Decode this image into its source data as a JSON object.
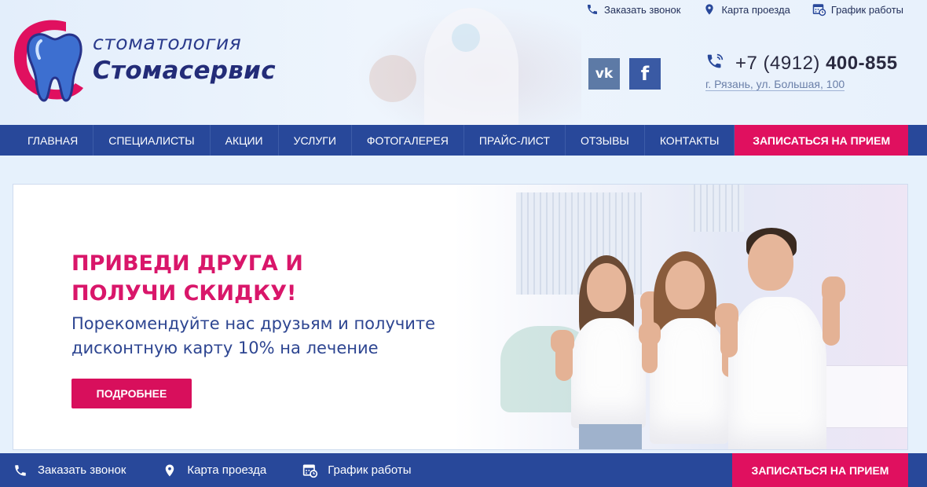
{
  "header": {
    "logo": {
      "top_text": "стоматология",
      "main_text": "Стомасервис"
    },
    "top_links": [
      {
        "label": "Заказать звонок",
        "icon": "phone-icon"
      },
      {
        "label": "Карта проезда",
        "icon": "map-pin-icon"
      },
      {
        "label": "График работы",
        "icon": "calendar-clock-icon"
      }
    ],
    "social": {
      "vk": "vk",
      "fb": "f"
    },
    "phone": {
      "prefix": "+7 (4912) ",
      "number": "400-855"
    },
    "address": "г. Рязань, ул. Большая, 100"
  },
  "nav": {
    "items": [
      "Главная",
      "Специалисты",
      "Акции",
      "Услуги",
      "Фотогалерея",
      "Прайс-лист",
      "Отзывы",
      "Контакты"
    ],
    "cta": "ЗАПИСАТЬСЯ НА ПРИЕМ"
  },
  "banner": {
    "title_line1": "Приведи друга и",
    "title_line2": "получи скидку!",
    "subtitle_line1": "Порекомендуйте нас друзьям и получите",
    "subtitle_line2": "дисконтную карту 10% на лечение",
    "button": "Подробнее"
  },
  "bottom_bar": {
    "items": [
      {
        "label": "Заказать звонок",
        "icon": "phone-icon"
      },
      {
        "label": "Карта проезда",
        "icon": "map-pin-icon"
      },
      {
        "label": "График работы",
        "icon": "calendar-clock-icon"
      }
    ],
    "cta": "ЗАПИСАТЬСЯ НА ПРИЕМ"
  },
  "colors": {
    "brand_blue": "#28489a",
    "accent_pink": "#e0105f",
    "background": "#e6f1fc"
  }
}
